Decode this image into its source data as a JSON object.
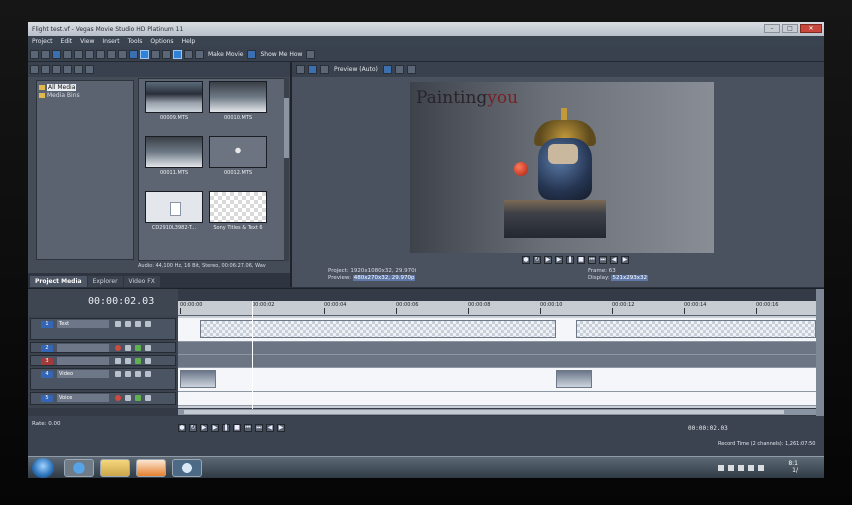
{
  "window": {
    "title": "Flight test.vf - Vegas Movie Studio HD Platinum 11"
  },
  "menu": [
    "Project",
    "Edit",
    "View",
    "Insert",
    "Tools",
    "Options",
    "Help"
  ],
  "toolbar": {
    "make_movie": "Make Movie",
    "show_me_how": "Show Me How"
  },
  "explorer": {
    "tree": [
      {
        "label": "All Media",
        "selected": true
      },
      {
        "label": "Media Bins",
        "selected": false
      }
    ],
    "clips": [
      {
        "name": "00009.MTS",
        "thumb": "crowd"
      },
      {
        "name": "00010.MTS",
        "thumb": "table"
      },
      {
        "name": "00011.MTS",
        "thumb": "table"
      },
      {
        "name": "00012.MTS",
        "thumb": "mini"
      },
      {
        "name": "CD2910L3982-T...",
        "thumb": "doc"
      },
      {
        "name": "Sony Titles & Text 6",
        "thumb": "check"
      }
    ],
    "status": "Audio: 44,100 Hz, 16 Bit, Stereo, 00:06:27.06, Wav",
    "tabs": [
      "Project Media",
      "Explorer",
      "Video FX"
    ]
  },
  "preview": {
    "mode": "Preview (Auto)",
    "overlay_text_1": "Painting",
    "overlay_text_2": "you",
    "project_label": "Project:",
    "project_value": "1920x1080x32, 29.970i",
    "preview_label": "Preview:",
    "preview_value": "480x270x32, 29.970p",
    "frame_label": "Frame:",
    "frame_value": "63",
    "display_label": "Display:",
    "display_value": "521x293x32"
  },
  "timeline": {
    "timecode": "00:00:02.03",
    "ruler": [
      "00:00:00",
      "00:00:02",
      "00:00:04",
      "00:00:06",
      "00:00:08",
      "00:00:10",
      "00:00:12",
      "00:00:14",
      "00:00:16"
    ],
    "tracks": [
      {
        "num": "1",
        "name": "Text"
      },
      {
        "num": "2",
        "name": ""
      },
      {
        "num": "3",
        "name": ""
      },
      {
        "num": "4",
        "name": "Video"
      },
      {
        "num": "5",
        "name": "Voice"
      }
    ],
    "rate": "Rate: 0.00",
    "position": "00:00:02.03",
    "record_time": "Record Time (2 channels): 1,261:07:50"
  },
  "taskbar": {
    "time": "8:1",
    "date": "1/"
  },
  "colors": {
    "accent": "#3b6fb0",
    "panel": "#444c58",
    "window_bg": "#2c323c"
  }
}
